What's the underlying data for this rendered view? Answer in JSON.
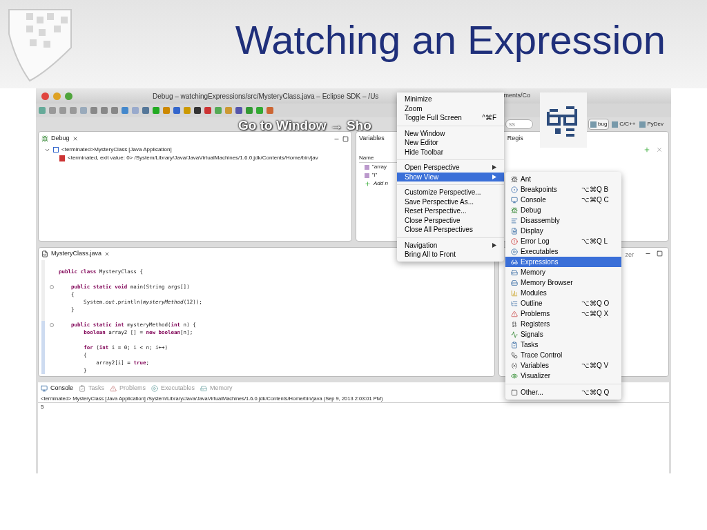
{
  "slide": {
    "title": "Watching an Expression"
  },
  "window": {
    "title": "Debug – watchingExpressions/src/MysteryClass.java – Eclipse SDK – /Us",
    "title_tail": "ments/Co"
  },
  "annotation": "Go to Window → Sho",
  "search": {
    "value": "ss"
  },
  "perspectives": [
    {
      "label": "bug",
      "selected": true
    },
    {
      "label": "C/C++",
      "selected": false
    },
    {
      "label": "PyDev",
      "selected": false
    }
  ],
  "debug_view": {
    "tab": "Debug",
    "tree": [
      {
        "label": "<terminated>MysteryClass [Java Application]",
        "expanded": true,
        "children": [
          {
            "label": "<terminated, exit value: 0> /System/Library/Java/JavaVirtualMachines/1.6.0.jdk/Contents/Home/bin/jav"
          }
        ]
      }
    ]
  },
  "variables_view": {
    "tabs": [
      "Variables",
      "Regis"
    ],
    "column": "Name",
    "rows": [
      "\"array",
      "\"i\""
    ],
    "add": "Add n"
  },
  "editor": {
    "tab": "MysteryClass.java",
    "lines": [
      {
        "fold": false,
        "marked": false
      },
      {
        "text": "**public class** MysteryClass {",
        "fold": false,
        "marked": false
      },
      {
        "fold": false,
        "marked": false
      },
      {
        "text": "    **public static void** main(String args[])",
        "fold": true,
        "marked": false
      },
      {
        "text": "    {",
        "fold": false,
        "marked": false
      },
      {
        "text": "        System.*out*.println(*mysteryMethod*(12));",
        "fold": false,
        "marked": false
      },
      {
        "text": "    }",
        "fold": false,
        "marked": false
      },
      {
        "fold": false,
        "marked": false
      },
      {
        "text": "    **public static int** mysteryMethod(**int** n) {",
        "fold": true,
        "marked": true
      },
      {
        "text": "        **boolean** array2 [] = **new boolean**[n];",
        "fold": false,
        "marked": true
      },
      {
        "fold": false,
        "marked": true
      },
      {
        "text": "        **for** (**int** i = 0; i < n; i++)",
        "fold": false,
        "marked": true
      },
      {
        "text": "        {",
        "fold": false,
        "marked": true
      },
      {
        "text": "            array2[i] = **true**;",
        "fold": false,
        "marked": true
      },
      {
        "text": "        }",
        "fold": false,
        "marked": true
      }
    ]
  },
  "side_view": {
    "tab": "zer"
  },
  "console": {
    "tabs": [
      {
        "label": "Console",
        "selected": true
      },
      {
        "label": "Tasks",
        "selected": false
      },
      {
        "label": "Problems",
        "selected": false
      },
      {
        "label": "Executables",
        "selected": false
      },
      {
        "label": "Memory",
        "selected": false
      }
    ],
    "status": "<terminated> MysteryClass [Java Application] /System/Library/Java/JavaVirtualMachines/1.6.0.jdk/Contents/Home/bin/java (Sep 9, 2013 2:03:01 PM)",
    "output": "5"
  },
  "window_menu": [
    {
      "kind": "item",
      "label": "Minimize",
      "selected": false
    },
    {
      "kind": "item",
      "label": "Zoom",
      "selected": false
    },
    {
      "kind": "item",
      "label": "Toggle Full Screen",
      "shortcut": "^⌘F",
      "selected": false
    },
    {
      "kind": "separator"
    },
    {
      "kind": "item",
      "label": "New Window",
      "selected": false
    },
    {
      "kind": "item",
      "label": "New Editor",
      "selected": false
    },
    {
      "kind": "item",
      "label": "Hide Toolbar",
      "selected": false
    },
    {
      "kind": "separator"
    },
    {
      "kind": "submenu",
      "label": "Open Perspective",
      "selected": false
    },
    {
      "kind": "submenu",
      "label": "Show View",
      "selected": true
    },
    {
      "kind": "separator"
    },
    {
      "kind": "item",
      "label": "Customize Perspective...",
      "selected": false
    },
    {
      "kind": "item",
      "label": "Save Perspective As...",
      "selected": false
    },
    {
      "kind": "item",
      "label": "Reset Perspective...",
      "selected": false
    },
    {
      "kind": "item",
      "label": "Close Perspective",
      "selected": false
    },
    {
      "kind": "item",
      "label": "Close All Perspectives",
      "selected": false
    },
    {
      "kind": "separator"
    },
    {
      "kind": "submenu",
      "label": "Navigation",
      "selected": false
    },
    {
      "kind": "item",
      "label": "Bring All to Front",
      "selected": false
    }
  ],
  "show_view_menu": [
    {
      "kind": "item",
      "label": "Ant",
      "selected": false
    },
    {
      "kind": "item",
      "label": "Breakpoints",
      "shortcut": "⌥⌘Q B",
      "selected": false
    },
    {
      "kind": "item",
      "label": "Console",
      "shortcut": "⌥⌘Q C",
      "selected": false
    },
    {
      "kind": "item",
      "label": "Debug",
      "selected": false
    },
    {
      "kind": "item",
      "label": "Disassembly",
      "selected": false
    },
    {
      "kind": "item",
      "label": "Display",
      "selected": false
    },
    {
      "kind": "item",
      "label": "Error Log",
      "shortcut": "⌥⌘Q L",
      "selected": false
    },
    {
      "kind": "item",
      "label": "Executables",
      "selected": false
    },
    {
      "kind": "item",
      "label": "Expressions",
      "selected": true
    },
    {
      "kind": "item",
      "label": "Memory",
      "selected": false
    },
    {
      "kind": "item",
      "label": "Memory Browser",
      "selected": false
    },
    {
      "kind": "item",
      "label": "Modules",
      "selected": false
    },
    {
      "kind": "item",
      "label": "Outline",
      "shortcut": "⌥⌘Q O",
      "selected": false
    },
    {
      "kind": "item",
      "label": "Problems",
      "shortcut": "⌥⌘Q X",
      "selected": false
    },
    {
      "kind": "item",
      "label": "Registers",
      "selected": false
    },
    {
      "kind": "item",
      "label": "Signals",
      "selected": false
    },
    {
      "kind": "item",
      "label": "Tasks",
      "selected": false
    },
    {
      "kind": "item",
      "label": "Trace Control",
      "selected": false
    },
    {
      "kind": "item",
      "label": "Variables",
      "shortcut": "⌥⌘Q V",
      "selected": false
    },
    {
      "kind": "item",
      "label": "Visualizer",
      "selected": false
    },
    {
      "kind": "separator"
    },
    {
      "kind": "item",
      "label": "Other...",
      "shortcut": "⌥⌘Q Q",
      "selected": false
    }
  ]
}
